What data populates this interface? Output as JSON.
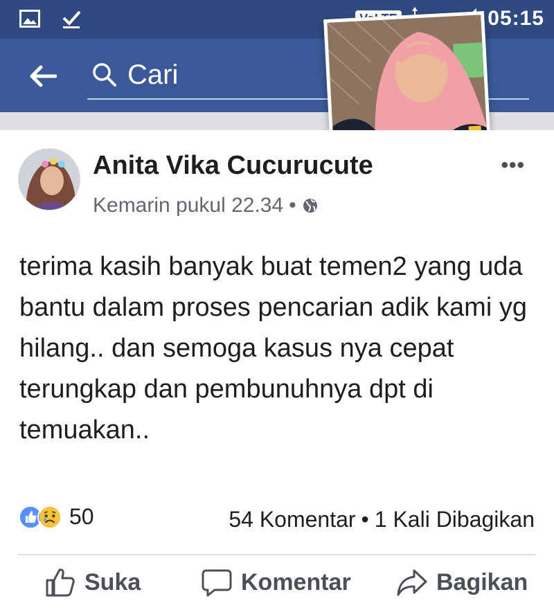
{
  "status_bar": {
    "volte": "VoLTE",
    "net": "4G",
    "clock": "05:15"
  },
  "app_bar": {
    "search_placeholder": "Cari"
  },
  "post": {
    "author": "Anita Vika Cucurucute",
    "timestamp": "Kemarin pukul 22.34",
    "separator": "•",
    "privacy_icon": "globe-icon",
    "text": "terima kasih banyak buat temen2 yang uda bantu dalam proses pencarian adik kami yg hilang.. dan semoga kasus nya cepat terungkap dan pembunuhnya dpt di temuakan..",
    "reactions": {
      "icons": [
        "like-icon",
        "sad-icon"
      ],
      "count": "50"
    },
    "comments_label": "54 Komentar",
    "shares_label": "1 Kali Dibagikan",
    "actions": {
      "like": "Suka",
      "comment": "Komentar",
      "share": "Bagikan"
    }
  },
  "colors": {
    "brand": "#3b5998",
    "status_bar": "#2f4a80",
    "like_blue": "#5890ff",
    "sad_yellow": "#f5c33b"
  }
}
